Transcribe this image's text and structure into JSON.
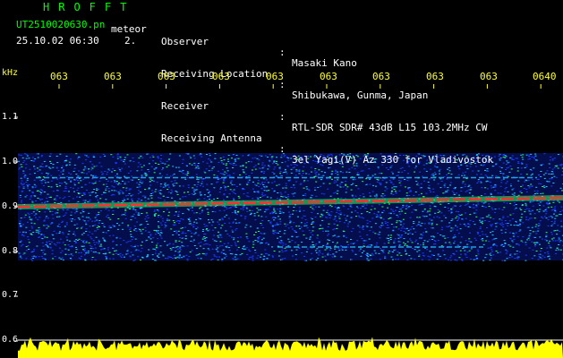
{
  "header": {
    "title": "HROFFT",
    "filename": "UT2510020630.pn",
    "mode": "meteor",
    "datetime": "25.10.02 06:30",
    "sequence": "2."
  },
  "info": [
    {
      "label": "Observer",
      "sep": ":",
      "value": "Masaki Kano"
    },
    {
      "label": "Receiving Location",
      "sep": ":",
      "value": "Shibukawa, Gunma, Japan"
    },
    {
      "label": "Receiver",
      "sep": ":",
      "value": "RTL-SDR SDR# 43dB L15 103.2MHz CW"
    },
    {
      "label": "Receiving Antenna",
      "sep": ":",
      "value": "3el Yagi(V) Az 330 for Vladivostok"
    }
  ],
  "colors": {
    "background": "#000000",
    "title_green": "#00ff00",
    "label_yellow": "#ffff33",
    "text_white": "#ffffff",
    "noise_blue": "#1b3cff",
    "noise_cyan": "#26c7ff",
    "signal_green": "#32ff5a",
    "carrier_red": "#ff3030",
    "level_yellow": "#ffff00"
  },
  "chart_data": {
    "type": "heatmap",
    "ylabel": "kHz",
    "x_ticks": [
      "063",
      "063",
      "063",
      "063",
      "063",
      "063",
      "063",
      "063",
      "063",
      "0640"
    ],
    "y_ticks": [
      "1.1",
      "1.0",
      "0.9",
      "0.8",
      "0.7",
      "0.6"
    ],
    "ylim": [
      0.6,
      1.15
    ],
    "noise_band": [
      0.78,
      1.02
    ],
    "carrier": {
      "start_khz": 0.9,
      "end_khz": 0.92
    },
    "faint_lines_khz": [
      0.965,
      0.81
    ],
    "grid": true
  }
}
